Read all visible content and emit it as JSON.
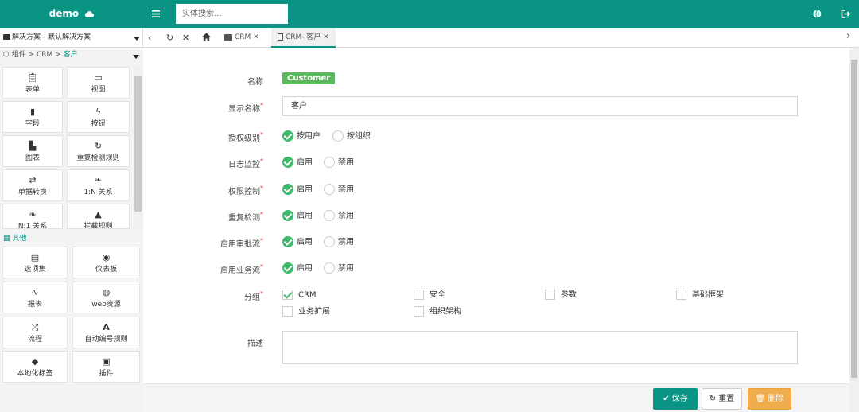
{
  "header": {
    "brand": "demo",
    "search_placeholder": "实体搜索..."
  },
  "tabs": {
    "solution": "解决方案 - 默认解决方案",
    "crm": "CRM",
    "crm_customer": "CRM- 客户"
  },
  "sidebar": {
    "crumb_root": "组件 > CRM > ",
    "crumb_current": "客户",
    "components": [
      "表单",
      "视图",
      "字段",
      "按钮",
      "图表",
      "重复检测规则",
      "单据转换",
      "1:N 关系",
      "N:1 关系",
      "拦截规则"
    ],
    "other_header": "其他",
    "other": [
      "选项集",
      "仪表板",
      "报表",
      "web资源",
      "流程",
      "自动编号规则",
      "本地化标签",
      "插件"
    ]
  },
  "form": {
    "name_label": "名称",
    "name_value": "Customer",
    "display_label": "显示名称",
    "display_value": "客户",
    "auth_label": "授权级别",
    "auth_user": "按用户",
    "auth_org": "按组织",
    "log_label": "日志监控",
    "perm_label": "权限控制",
    "dup_label": "重复检测",
    "approval_label": "启用审批流",
    "biz_label": "启用业务流",
    "enable": "启用",
    "disable": "禁用",
    "group_label": "分组",
    "groups": [
      "CRM",
      "安全",
      "参数",
      "基础框架",
      "业务扩展",
      "组织架构"
    ],
    "desc_label": "描述",
    "required_mark": "*"
  },
  "footer": {
    "save": "保存",
    "reset": "重置",
    "delete": "删除"
  },
  "colors": {
    "primary": "#0a9484",
    "success": "#3eb86b",
    "badge": "#5cb85c",
    "warning": "#f0ad4e"
  }
}
